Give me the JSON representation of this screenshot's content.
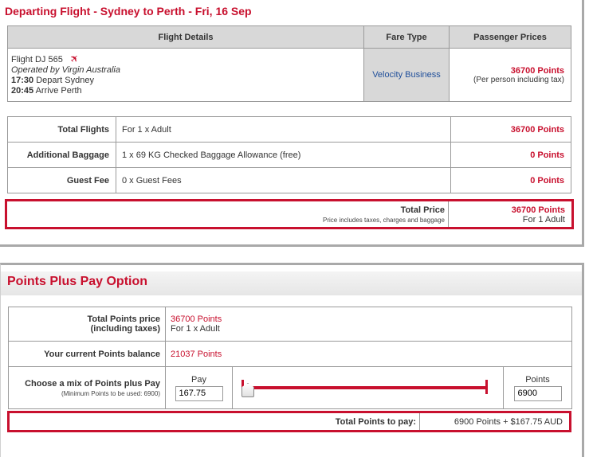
{
  "departing": {
    "title": "Departing Flight - Sydney to Perth - Fri, 16 Sep",
    "headers": {
      "details": "Flight Details",
      "fare": "Fare Type",
      "prices": "Passenger Prices"
    },
    "flight": {
      "number": "Flight DJ 565",
      "operated_by": "Operated by Virgin Australia",
      "depart_time": "17:30",
      "depart_label": "Depart Sydney",
      "arrive_time": "20:45",
      "arrive_label": "Arrive Perth",
      "fare_type": "Velocity Business",
      "price": "36700 Points",
      "price_note": "(Per person including tax)",
      "icon": "plane-icon"
    }
  },
  "summary": {
    "rows": [
      {
        "label": "Total Flights",
        "desc": "For 1 x Adult",
        "value": "36700 Points"
      },
      {
        "label": "Additional Baggage",
        "desc": "1 x 69 KG Checked Baggage Allowance (free)",
        "value": "0 Points"
      },
      {
        "label": "Guest Fee",
        "desc": "0 x Guest Fees",
        "value": "0 Points"
      }
    ],
    "total": {
      "title": "Total Price",
      "note": "Price includes taxes, charges and baggage",
      "value": "36700 Points",
      "sub": "For 1 Adult"
    }
  },
  "points_plus_pay": {
    "title": "Points Plus Pay Option",
    "total_points_label": "Total Points price",
    "total_points_label2": "(including taxes)",
    "total_points_value": "36700 Points",
    "total_points_sub": "For 1 x Adult",
    "balance_label": "Your current Points balance",
    "balance_value": "21037 Points",
    "mix_label": "Choose a mix of Points plus Pay",
    "mix_note": "(Minimum Points to be used: 6900)",
    "pay_label": "Pay",
    "pay_value": "167.75",
    "points_label": "Points",
    "points_value": "6900",
    "slider_fraction": 0,
    "total_to_pay_label": "Total Points to pay:",
    "total_to_pay_value": "6900 Points + $167.75 AUD"
  },
  "colors": {
    "accent": "#c8102e",
    "fare_text": "#1f4e9a",
    "header_bg": "#d8d8d8"
  }
}
